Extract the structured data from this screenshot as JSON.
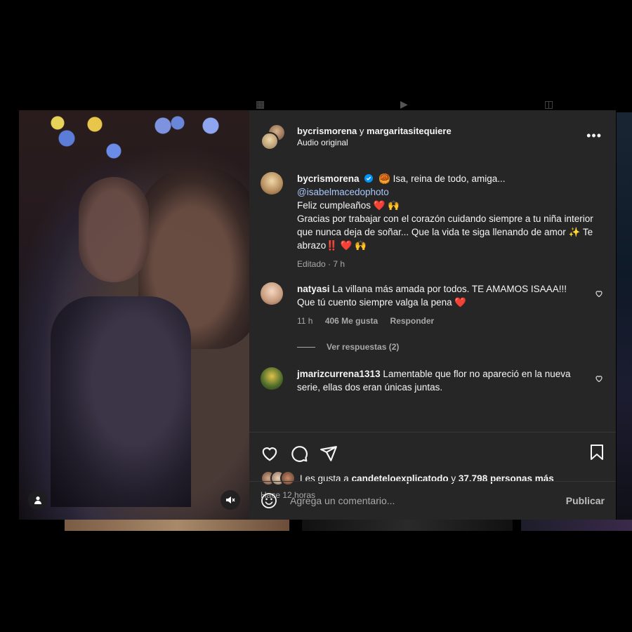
{
  "post": {
    "author": "bycrismorena",
    "connector": "y",
    "collaborator": "margaritasitequiere",
    "audio": "Audio original",
    "caption": {
      "username": "bycrismorena",
      "line1": "🥮 Isa, reina de todo, amiga...",
      "mention": "@isabelmacedophoto",
      "line2": "Feliz cumpleaños ❤️ 🙌",
      "line3": "Gracias por trabajar con el corazón cuidando siempre a tu niña interior que nunca deja de soñar... Que la vida te siga llenando de amor ✨ Te abrazo‼️ ❤️ 🙌",
      "meta": "Editado · 7 h"
    }
  },
  "comments": [
    {
      "username": "natyasi",
      "text": "La villana más amada por todos. TE AMAMOS ISAAA!!! Que tú cuento siempre valga la pena ❤️",
      "time": "11 h",
      "likes": "406 Me gusta",
      "reply": "Responder",
      "view_replies": "Ver respuestas (2)"
    },
    {
      "username": "jmarizcurrena1313",
      "text": "Lamentable que flor no apareció en la nueva serie, ellas dos eran únicas juntas."
    }
  ],
  "likes": {
    "prefix": "Les gusta a",
    "user": "candeteloexplicatodo",
    "connector": "y",
    "others": "37.798 personas más"
  },
  "timestamp": "Hace 12 horas",
  "composer": {
    "placeholder": "Agrega un comentario...",
    "publish": "Publicar"
  },
  "icons": {
    "header_more": "more-horizontal-icon",
    "like": "heart-icon",
    "comment": "comment-icon",
    "share": "share-icon",
    "save": "bookmark-icon",
    "emoji": "emoji-icon",
    "tag": "user-icon",
    "mute": "mute-icon"
  },
  "colors": {
    "panel_bg": "#262626",
    "secondary_text": "#a8a8a8",
    "link": "#a8c7fa",
    "verified": "#0095f6"
  }
}
